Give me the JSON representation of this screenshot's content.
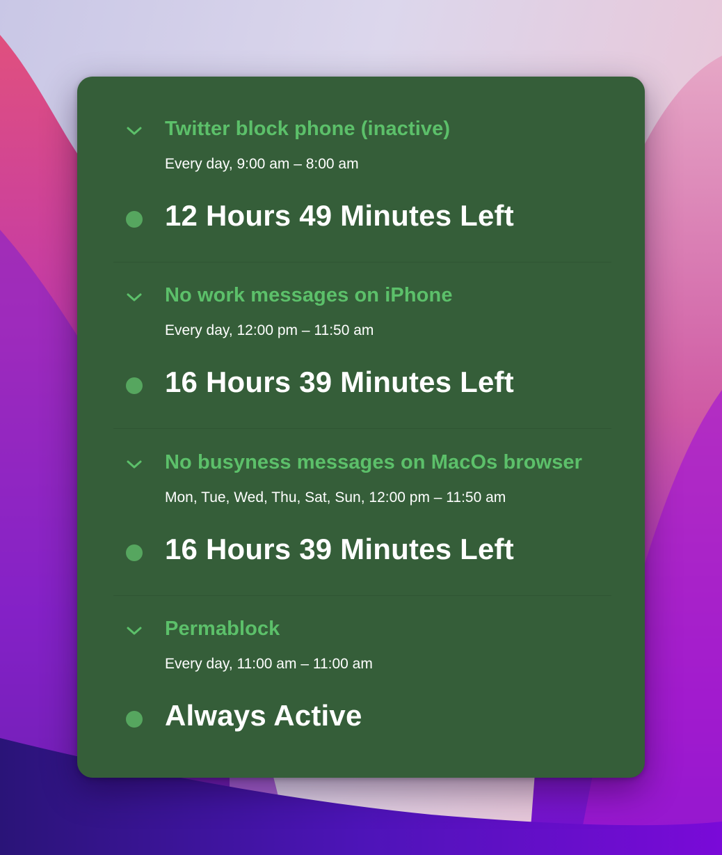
{
  "colors": {
    "panel": "#355e39",
    "title": "#5cc06a",
    "dot": "#56a65f",
    "text": "#ffffff"
  },
  "blocks": [
    {
      "title": "Twitter block phone (inactive)",
      "schedule": "Every day, 9:00 am – 8:00 am",
      "status": "12 Hours 49 Minutes Left",
      "icon": "chevron-down-icon"
    },
    {
      "title": "No work messages on iPhone",
      "schedule": "Every day, 12:00 pm – 11:50 am",
      "status": "16 Hours 39 Minutes Left",
      "icon": "chevron-down-icon"
    },
    {
      "title": "No busyness messages on MacOs browser",
      "schedule": "Mon, Tue, Wed, Thu, Sat, Sun, 12:00 pm – 11:50 am",
      "status": "16 Hours 39 Minutes Left",
      "icon": "chevron-down-icon"
    },
    {
      "title": "Permablock",
      "schedule": "Every day, 11:00 am – 11:00 am",
      "status": "Always Active",
      "icon": "chevron-down-icon"
    }
  ]
}
